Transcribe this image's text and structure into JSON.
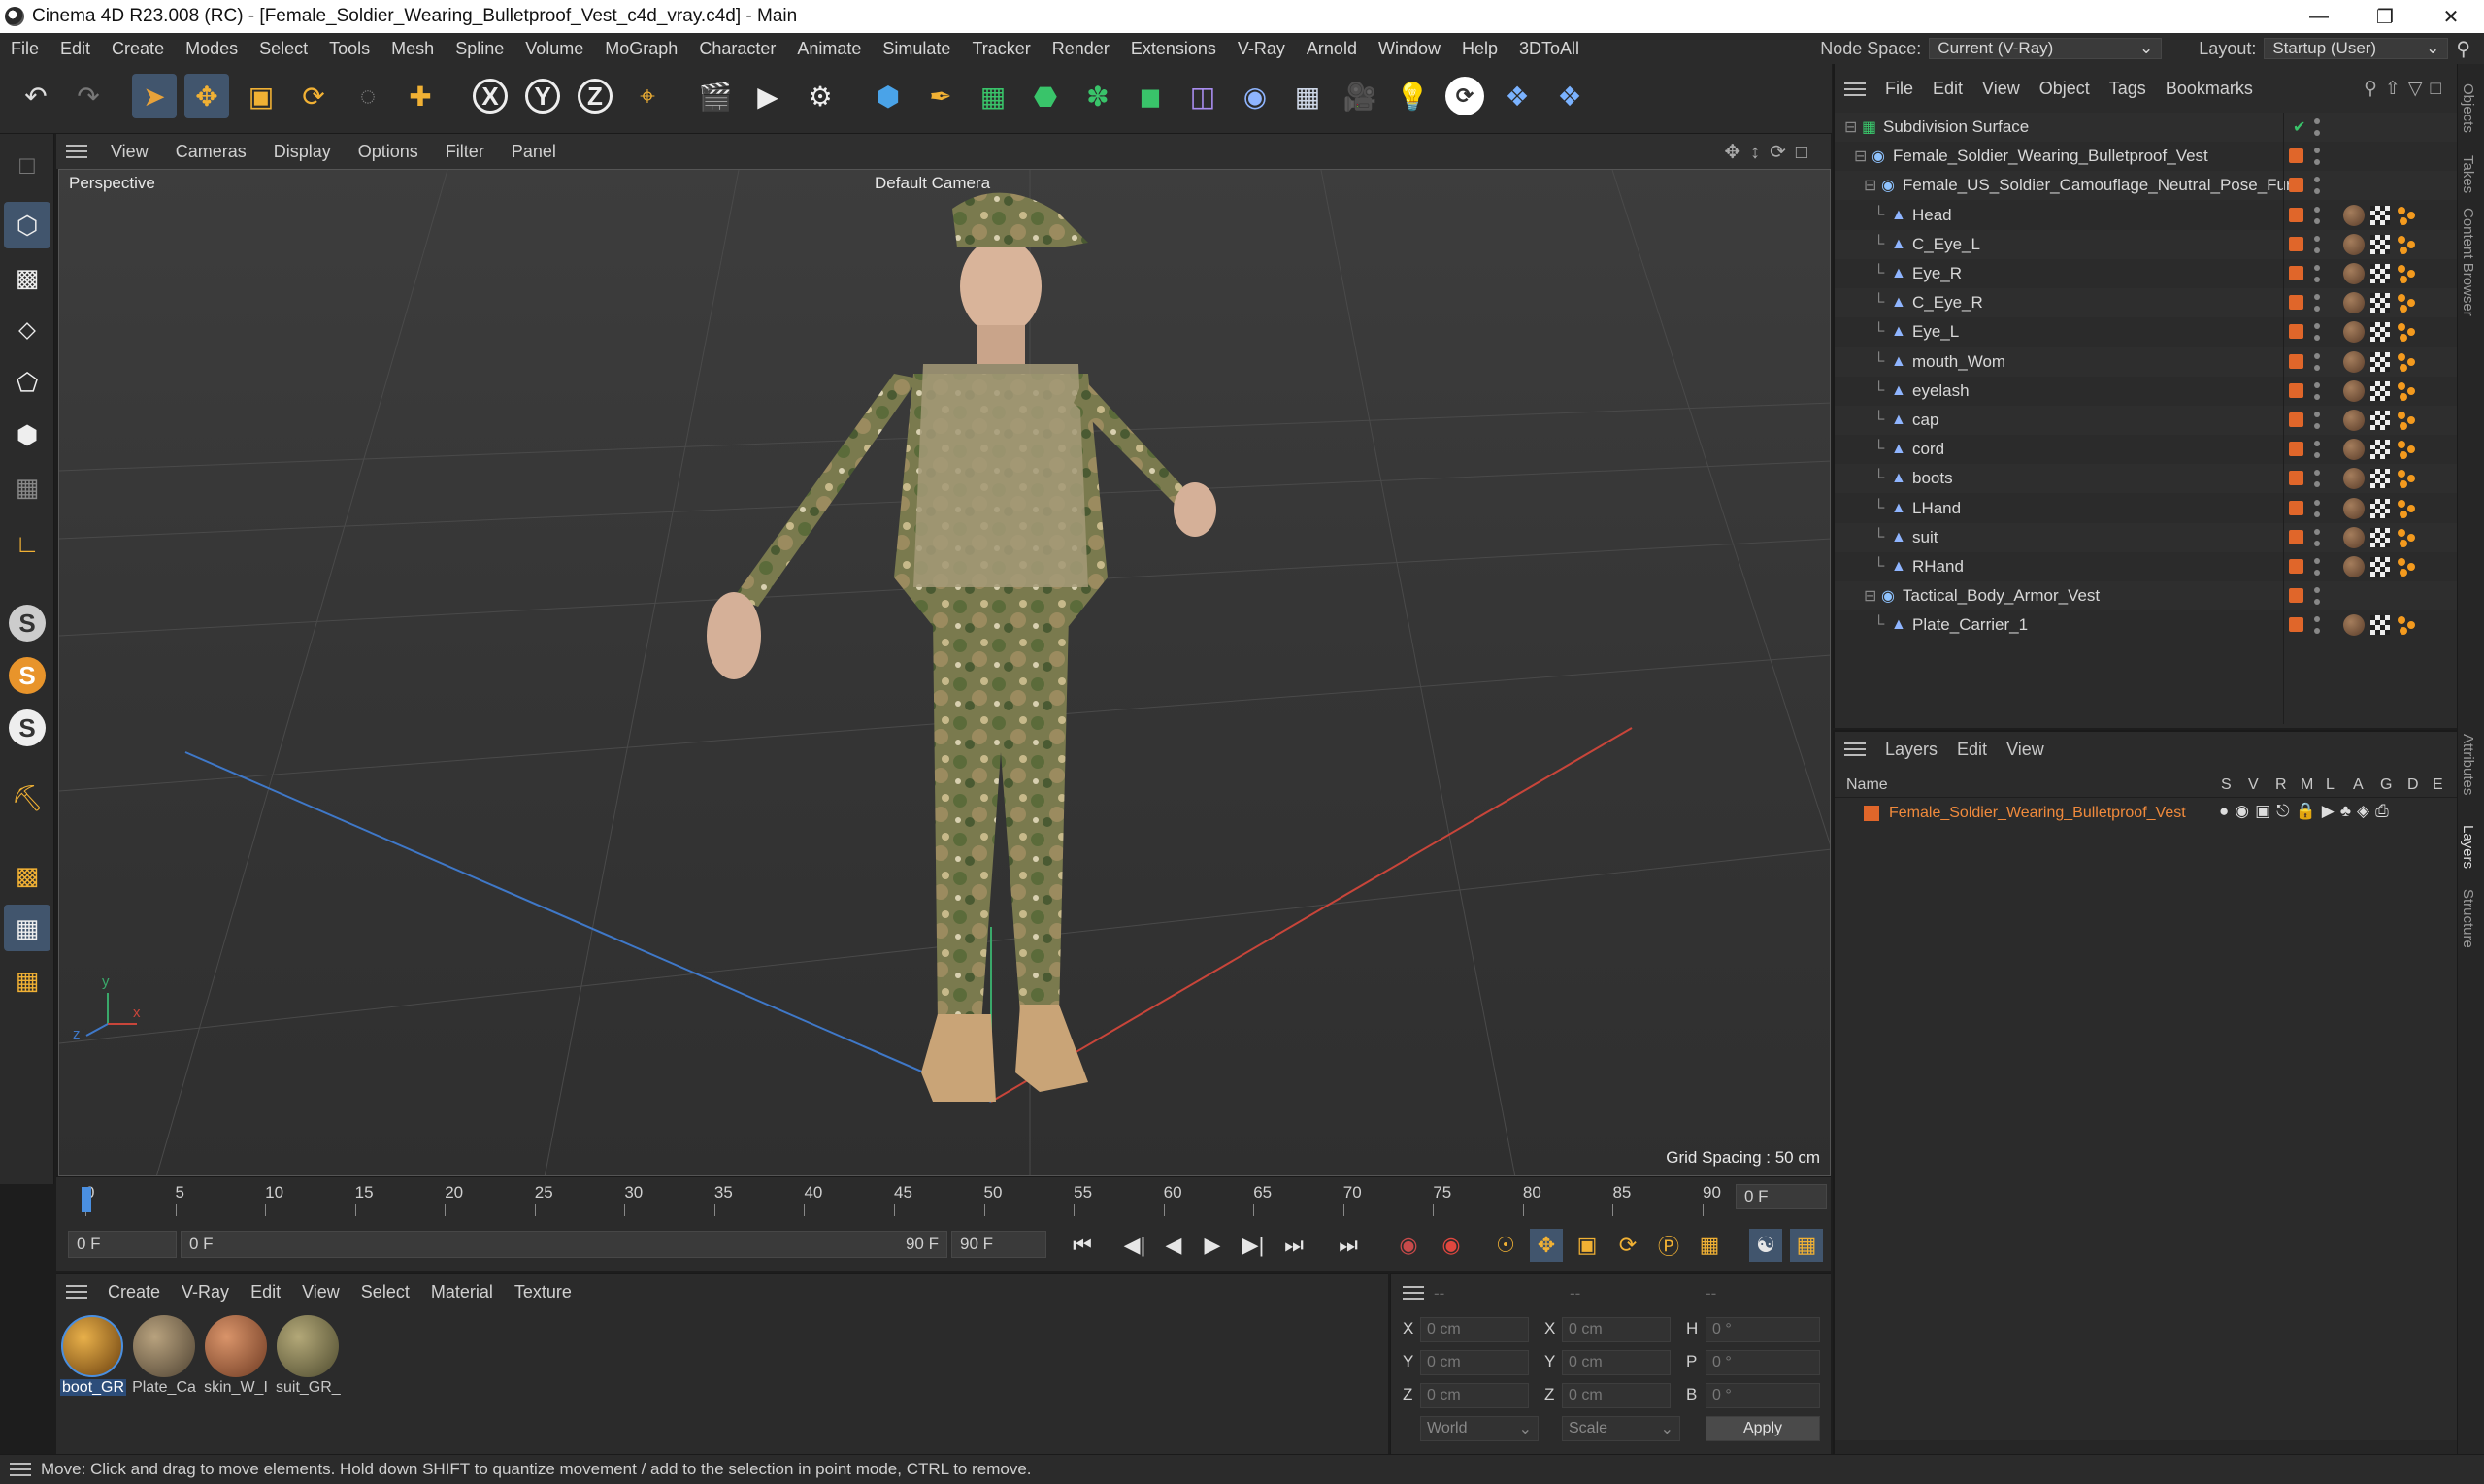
{
  "window": {
    "title": "Cinema 4D R23.008 (RC) - [Female_Soldier_Wearing_Bulletproof_Vest_c4d_vray.c4d] - Main"
  },
  "menu": {
    "items": [
      "File",
      "Edit",
      "Create",
      "Modes",
      "Select",
      "Tools",
      "Mesh",
      "Spline",
      "Volume",
      "MoGraph",
      "Character",
      "Animate",
      "Simulate",
      "Tracker",
      "Render",
      "Extensions",
      "V-Ray",
      "Arnold",
      "Window",
      "Help",
      "3DToAll"
    ],
    "node_space_label": "Node Space:",
    "node_space_value": "Current (V-Ray)",
    "layout_label": "Layout:",
    "layout_value": "Startup (User)"
  },
  "viewport": {
    "menu": [
      "View",
      "Cameras",
      "Display",
      "Options",
      "Filter",
      "Panel"
    ],
    "projection": "Perspective",
    "camera": "Default Camera",
    "grid_spacing": "Grid Spacing : 50 cm",
    "axis_x": "x",
    "axis_y": "y",
    "axis_z": "z"
  },
  "objects": {
    "menu": [
      "File",
      "Edit",
      "View",
      "Object",
      "Tags",
      "Bookmarks"
    ],
    "rows": [
      {
        "name": "Subdivision Surface",
        "level": 0,
        "icon": "subdivision-icon"
      },
      {
        "name": "Female_Soldier_Wearing_Bulletproof_Vest",
        "level": 1,
        "icon": "null-icon"
      },
      {
        "name": "Female_US_Soldier_Camouflage_Neutral_Pose_Fur",
        "level": 2,
        "icon": "null-icon"
      },
      {
        "name": "Head",
        "level": 3,
        "icon": "polygon-icon"
      },
      {
        "name": "C_Eye_L",
        "level": 3,
        "icon": "polygon-icon"
      },
      {
        "name": "Eye_R",
        "level": 3,
        "icon": "polygon-icon"
      },
      {
        "name": "C_Eye_R",
        "level": 3,
        "icon": "polygon-icon"
      },
      {
        "name": "Eye_L",
        "level": 3,
        "icon": "polygon-icon"
      },
      {
        "name": "mouth_Wom",
        "level": 3,
        "icon": "polygon-icon"
      },
      {
        "name": "eyelash",
        "level": 3,
        "icon": "polygon-icon"
      },
      {
        "name": "cap",
        "level": 3,
        "icon": "polygon-icon"
      },
      {
        "name": "cord",
        "level": 3,
        "icon": "polygon-icon"
      },
      {
        "name": "boots",
        "level": 3,
        "icon": "polygon-icon"
      },
      {
        "name": "LHand",
        "level": 3,
        "icon": "polygon-icon"
      },
      {
        "name": "suit",
        "level": 3,
        "icon": "polygon-icon"
      },
      {
        "name": "RHand",
        "level": 3,
        "icon": "polygon-icon"
      },
      {
        "name": "Tactical_Body_Armor_Vest",
        "level": 2,
        "icon": "null-icon"
      },
      {
        "name": "Plate_Carrier_1",
        "level": 3,
        "icon": "polygon-icon"
      }
    ]
  },
  "layers": {
    "menu": [
      "Layers",
      "Edit",
      "View"
    ],
    "col_name": "Name",
    "cols": [
      "S",
      "V",
      "R",
      "M",
      "L",
      "A",
      "G",
      "D",
      "E"
    ],
    "rows": [
      {
        "name": "Female_Soldier_Wearing_Bulletproof_Vest",
        "color": "#e0662a"
      }
    ]
  },
  "side_tabs": [
    "Objects",
    "Takes",
    "Content Browser",
    "Attributes",
    "Layers",
    "Structure"
  ],
  "timeline": {
    "ticks": [
      "0",
      "5",
      "10",
      "15",
      "20",
      "25",
      "30",
      "35",
      "40",
      "45",
      "50",
      "55",
      "60",
      "65",
      "70",
      "75",
      "80",
      "85",
      "90"
    ],
    "current_frame": "0 F",
    "start": "0 F",
    "range_start": "0 F",
    "range_end": "90 F",
    "end": "90 F"
  },
  "materials": {
    "menu": [
      "Create",
      "V-Ray",
      "Edit",
      "View",
      "Select",
      "Material",
      "Texture"
    ],
    "items": [
      {
        "label": "boot_GR",
        "selected": true
      },
      {
        "label": "Plate_Ca",
        "selected": false
      },
      {
        "label": "skin_W_I",
        "selected": false
      },
      {
        "label": "suit_GR_",
        "selected": false
      }
    ]
  },
  "coords": {
    "col_headers": [
      "--",
      "--",
      "--"
    ],
    "rows": [
      {
        "a": "X",
        "av": "0 cm",
        "b": "X",
        "bv": "0 cm",
        "c": "H",
        "cv": "0 °"
      },
      {
        "a": "Y",
        "av": "0 cm",
        "b": "Y",
        "bv": "0 cm",
        "c": "P",
        "cv": "0 °"
      },
      {
        "a": "Z",
        "av": "0 cm",
        "b": "Z",
        "bv": "0 cm",
        "c": "B",
        "cv": "0 °"
      }
    ],
    "mode": "World",
    "scale": "Scale",
    "apply": "Apply"
  },
  "status": {
    "text": "Move: Click and drag to move elements. Hold down SHIFT to quantize movement / add to the selection in point mode, CTRL to remove."
  },
  "colors": {
    "accent_orange": "#e0662a",
    "selection_blue": "#41556d",
    "layer_text": "#f08a3c"
  }
}
